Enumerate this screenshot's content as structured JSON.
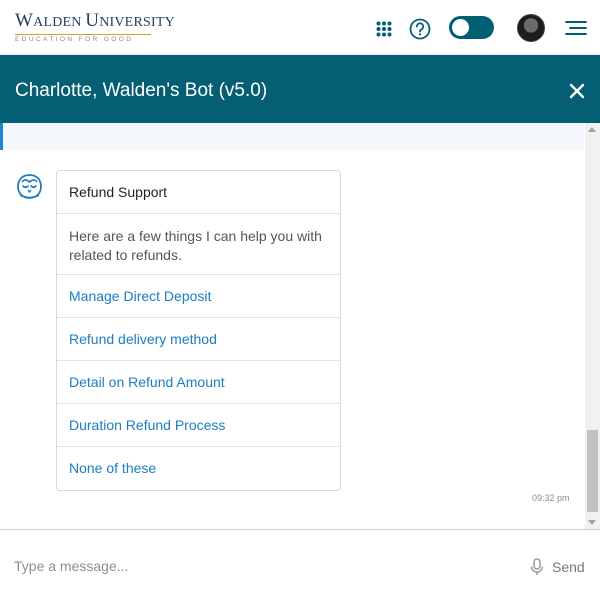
{
  "logo": {
    "name_first_cap": "W",
    "name_rest": "ALDEN ",
    "name_second_cap": "U",
    "name_second_rest": "NIVERSITY",
    "tagline": "EDUCATION FOR GOOD"
  },
  "topnav": {
    "icons": [
      "apps-grid-icon",
      "help-icon",
      "toggle",
      "avatar",
      "menu-icon"
    ],
    "toggle_state": "off",
    "accent_color": "#005f73"
  },
  "chat": {
    "title": "Charlotte, Walden's Bot (v5.0)",
    "header_color": "#045f75",
    "close_label": "close"
  },
  "message": {
    "card_title": "Refund Support",
    "description": "Here are a few things I can help you with related to refunds.",
    "options": [
      "Manage Direct Deposit",
      "Refund delivery method",
      "Detail on Refund Amount",
      "Duration Refund Process",
      "None of these"
    ],
    "timestamp": "09:32 pm",
    "link_color": "#1a7ec0"
  },
  "footer": {
    "placeholder": "Type a message...",
    "send_label": "Send"
  }
}
